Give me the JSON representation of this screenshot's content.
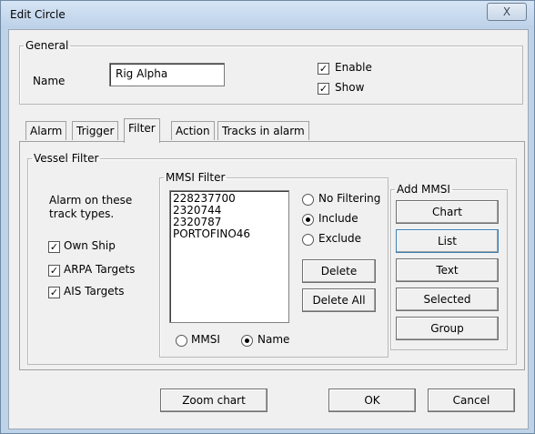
{
  "window": {
    "title": "Edit Circle",
    "close_glyph": "X"
  },
  "general": {
    "legend": "General",
    "name_label": "Name",
    "name_value": "Rig Alpha",
    "enable_label": "Enable",
    "show_label": "Show",
    "enable_checked": true,
    "show_checked": true
  },
  "tabs": [
    "Alarm",
    "Trigger",
    "Filter",
    "Action",
    "Tracks in alarm"
  ],
  "active_tab": "Filter",
  "vessel_filter": {
    "legend": "Vessel Filter",
    "alarm_text_1": "Alarm on these",
    "alarm_text_2": "track types.",
    "own_ship": "Own Ship",
    "arpa": "ARPA Targets",
    "ais": "AIS Targets"
  },
  "mmsi_filter": {
    "legend": "MMSI Filter",
    "items": [
      "228237700",
      "2320744",
      "2320787",
      "PORTOFINO46"
    ],
    "no_filtering": "No Filtering",
    "include": "Include",
    "exclude": "Exclude",
    "selected_mode": "Include",
    "delete": "Delete",
    "delete_all": "Delete All",
    "mmsi_radio": "MMSI",
    "name_radio": "Name",
    "selected_key": "Name"
  },
  "add_mmsi": {
    "legend": "Add MMSI",
    "chart": "Chart",
    "list": "List",
    "text": "Text",
    "selected": "Selected",
    "group": "Group"
  },
  "footer": {
    "zoom_chart": "Zoom chart",
    "ok": "OK",
    "cancel": "Cancel"
  }
}
